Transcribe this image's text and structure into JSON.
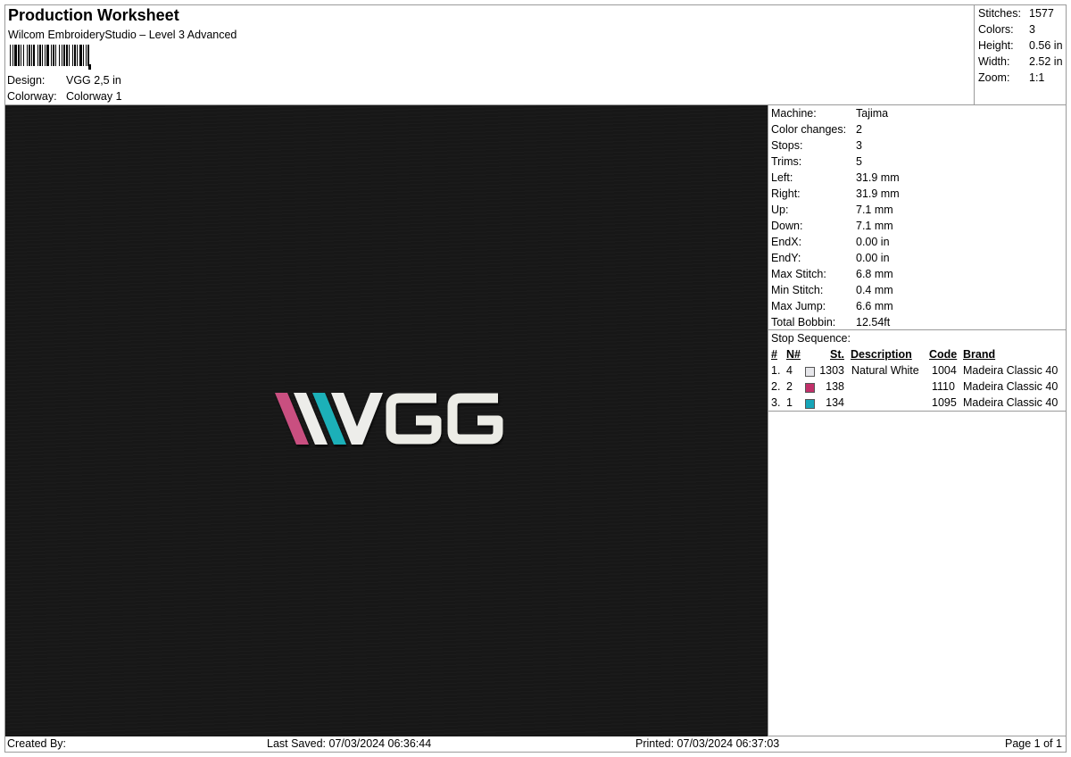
{
  "header": {
    "title": "Production Worksheet",
    "subtitle": "Wilcom EmbroideryStudio – Level 3 Advanced",
    "design_label": "Design:",
    "design_value": "VGG 2,5 in",
    "colorway_label": "Colorway:",
    "colorway_value": "Colorway 1"
  },
  "summary": [
    {
      "label": "Stitches:",
      "value": "1577"
    },
    {
      "label": "Colors:",
      "value": "3"
    },
    {
      "label": "Height:",
      "value": "0.56 in"
    },
    {
      "label": "Width:",
      "value": "2.52 in"
    },
    {
      "label": "Zoom:",
      "value": "1:1"
    }
  ],
  "design_preview": {
    "logo_text": "VGG",
    "background_color": "#171717",
    "stripe_colors": [
      "#c94f80",
      "#ededea",
      "#1fb0b8",
      "#ededea"
    ],
    "letter_color": "#ecece6"
  },
  "machine_info": [
    {
      "label": "Machine:",
      "value": "Tajima"
    },
    {
      "label": "Color changes:",
      "value": "2"
    },
    {
      "label": "Stops:",
      "value": "3"
    },
    {
      "label": "Trims:",
      "value": "5"
    },
    {
      "label": "Left:",
      "value": "31.9 mm"
    },
    {
      "label": "Right:",
      "value": "31.9 mm"
    },
    {
      "label": "Up:",
      "value": "7.1 mm"
    },
    {
      "label": "Down:",
      "value": "7.1 mm"
    },
    {
      "label": "EndX:",
      "value": "0.00 in"
    },
    {
      "label": "EndY:",
      "value": "0.00 in"
    },
    {
      "label": "Max Stitch:",
      "value": "6.8 mm"
    },
    {
      "label": "Min Stitch:",
      "value": "0.4 mm"
    },
    {
      "label": "Max Jump:",
      "value": "6.6 mm"
    },
    {
      "label": "Total Bobbin:",
      "value": "12.54ft"
    }
  ],
  "stop_sequence": {
    "title": "Stop Sequence:",
    "headers": {
      "num": "#",
      "n": "N#",
      "st": "St.",
      "description": "Description",
      "code": "Code",
      "brand": "Brand"
    },
    "rows": [
      {
        "num": "1.",
        "n": "4",
        "swatch": "#e6e6ea",
        "st": "1303",
        "description": "Natural White",
        "code": "1004",
        "brand": "Madeira Classic 40"
      },
      {
        "num": "2.",
        "n": "2",
        "swatch": "#c2306a",
        "st": "138",
        "description": "",
        "code": "1110",
        "brand": "Madeira Classic 40"
      },
      {
        "num": "3.",
        "n": "1",
        "swatch": "#16a5b8",
        "st": "134",
        "description": "",
        "code": "1095",
        "brand": "Madeira Classic 40"
      }
    ]
  },
  "footer": {
    "created_by": "Created By:",
    "last_saved": "Last Saved: 07/03/2024 06:36:44",
    "printed": "Printed: 07/03/2024 06:37:03",
    "page": "Page 1 of 1"
  }
}
